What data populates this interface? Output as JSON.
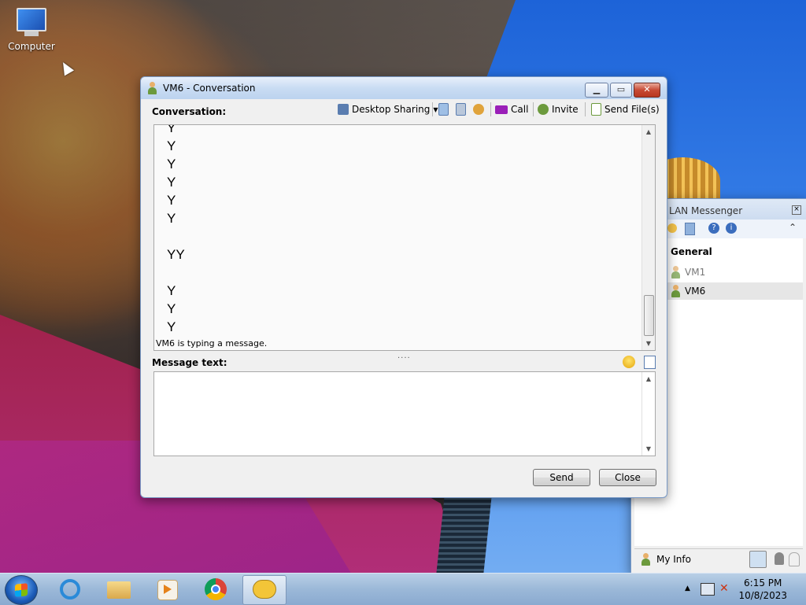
{
  "desktop": {
    "icons": [
      {
        "label": "Computer",
        "icon": "computer-icon"
      }
    ]
  },
  "conversation_window": {
    "title": "VM6 - Conversation",
    "title_icon": "user-icon",
    "toolbar": {
      "label": "Conversation:",
      "desktop_sharing": "Desktop Sharing",
      "call": "Call",
      "invite": "Invite",
      "send_files": "Send File(s)"
    },
    "messages": [
      "Y",
      "Y",
      "Y",
      "Y",
      "Y",
      "Y",
      "",
      "YY",
      "",
      "Y",
      "Y",
      "Y"
    ],
    "typing_status": "VM6 is typing a message.",
    "message_text_label": "Message text:",
    "message_input_value": "",
    "buttons": {
      "send": "Send",
      "close": "Close"
    }
  },
  "lan_messenger": {
    "title": "LAN Messenger",
    "group": "General",
    "contacts": [
      {
        "name": "VM1",
        "status": "offline"
      },
      {
        "name": "VM6",
        "status": "online",
        "selected": true
      }
    ],
    "my_info": "My Info"
  },
  "taskbar": {
    "apps": [
      "internet-explorer-icon",
      "file-explorer-icon",
      "media-player-icon",
      "chrome-icon",
      "lan-messenger-icon"
    ],
    "time": "6:15 PM",
    "date": "10/8/2023"
  },
  "colors": {
    "titlebar": "#c9dcf3",
    "close_button": "#c74a35",
    "selected_row": "#e6e6e6"
  }
}
